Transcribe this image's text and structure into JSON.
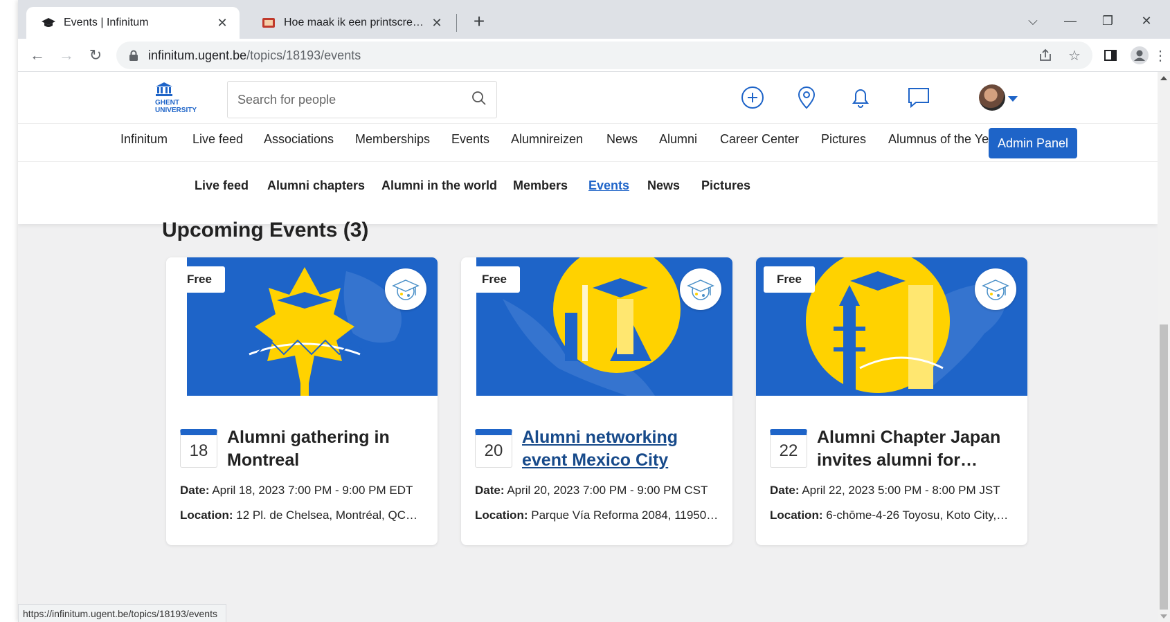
{
  "browser": {
    "tabs": [
      {
        "title": "Events | Infinitum",
        "active": true
      },
      {
        "title": "Hoe maak ik een printscreen op een",
        "active": false
      }
    ],
    "url_host": "infinitum.ugent.be",
    "url_path": "/topics/18193/events",
    "status_url": "https://infinitum.ugent.be/topics/18193/events"
  },
  "header": {
    "logo_line1": "GHENT",
    "logo_line2": "UNIVERSITY",
    "search_placeholder": "Search for people"
  },
  "main_nav": {
    "items": [
      "Infinitum",
      "Live feed",
      "Associations",
      "Memberships",
      "Events",
      "Alumnireizen",
      "News",
      "Alumni",
      "Career Center",
      "Pictures",
      "Alumnus of the Year"
    ],
    "admin_label": "Admin Panel"
  },
  "sub_nav": {
    "items": [
      "Live feed",
      "Alumni chapters",
      "Alumni in the world",
      "Members",
      "Events",
      "News",
      "Pictures"
    ],
    "active": "Events"
  },
  "section": {
    "title": "Upcoming Events (3)"
  },
  "events": [
    {
      "badge": "Free",
      "day": "18",
      "title": "Alumni gathering in Montreal",
      "date_label": "Date:",
      "date": "April 18, 2023 7:00 PM - 9:00 PM EDT",
      "location_label": "Location:",
      "location": "12 Pl. de Chelsea, Montréal, QC…"
    },
    {
      "badge": "Free",
      "day": "20",
      "title": "Alumni networking event Mexico City",
      "date_label": "Date:",
      "date": "April 20, 2023 7:00 PM - 9:00 PM CST",
      "location_label": "Location:",
      "location": "Parque Vía Reforma 2084, 11950…"
    },
    {
      "badge": "Free",
      "day": "22",
      "title": "Alumni Chapter Japan invites alumni for…",
      "date_label": "Date:",
      "date": "April 22, 2023 5:00 PM - 8:00 PM JST",
      "location_label": "Location:",
      "location": "6-chōme-4-26 Toyosu, Koto City,…"
    }
  ],
  "colors": {
    "brand_blue": "#1e64c8",
    "accent_yellow": "#ffd200",
    "page_bg": "#f0f0f1"
  }
}
